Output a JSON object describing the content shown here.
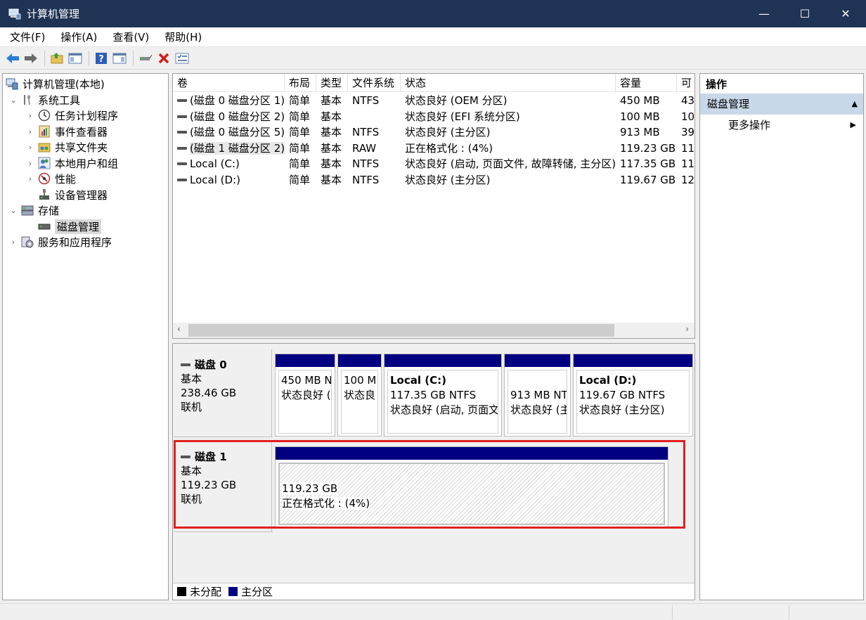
{
  "window": {
    "title": "计算机管理",
    "minimize": "—",
    "maximize": "☐",
    "close": "✕"
  },
  "menu": [
    "文件(F)",
    "操作(A)",
    "查看(V)",
    "帮助(H)"
  ],
  "toolbar_icons": [
    "back-arrow-icon",
    "forward-arrow-icon",
    "up-folder-icon",
    "show-hide-tree-icon",
    "help-icon",
    "properties-icon",
    "connect-drive-icon",
    "delete-icon",
    "checklist-icon"
  ],
  "tree": {
    "root": "计算机管理(本地)",
    "items": [
      {
        "label": "系统工具",
        "level": 1,
        "expanded": true
      },
      {
        "label": "任务计划程序",
        "level": 2
      },
      {
        "label": "事件查看器",
        "level": 2
      },
      {
        "label": "共享文件夹",
        "level": 2
      },
      {
        "label": "本地用户和组",
        "level": 2
      },
      {
        "label": "性能",
        "level": 2
      },
      {
        "label": "设备管理器",
        "level": 2
      },
      {
        "label": "存储",
        "level": 1,
        "expanded": true
      },
      {
        "label": "磁盘管理",
        "level": 2,
        "selected": true
      },
      {
        "label": "服务和应用程序",
        "level": 1
      }
    ]
  },
  "volume_list": {
    "columns": [
      "卷",
      "布局",
      "类型",
      "文件系统",
      "状态",
      "容量",
      "可"
    ],
    "rows": [
      [
        "(磁盘 0 磁盘分区 1)",
        "简单",
        "基本",
        "NTFS",
        "状态良好 (OEM 分区)",
        "450 MB",
        "43"
      ],
      [
        "(磁盘 0 磁盘分区 2)",
        "简单",
        "基本",
        "",
        "状态良好 (EFI 系统分区)",
        "100 MB",
        "10"
      ],
      [
        "(磁盘 0 磁盘分区 5)",
        "简单",
        "基本",
        "NTFS",
        "状态良好 (主分区)",
        "913 MB",
        "39"
      ],
      [
        "(磁盘 1 磁盘分区 2)",
        "简单",
        "基本",
        "RAW",
        "正在格式化 : (4%)",
        "119.23 GB",
        "11"
      ],
      [
        "Local (C:)",
        "简单",
        "基本",
        "NTFS",
        "状态良好 (启动, 页面文件, 故障转储, 主分区)",
        "117.35 GB",
        "11"
      ],
      [
        "Local (D:)",
        "简单",
        "基本",
        "NTFS",
        "状态良好 (主分区)",
        "119.67 GB",
        "12"
      ]
    ],
    "scroll_left": "‹",
    "scroll_right": "›"
  },
  "disks": [
    {
      "name": "磁盘 0",
      "type": "基本",
      "size": "238.46 GB",
      "state": "联机",
      "partitions": [
        {
          "name": "",
          "line1": "450 MB N",
          "line2": "状态良好 ("
        },
        {
          "name": "",
          "line1": "100 M",
          "line2": "状态良"
        },
        {
          "name": "Local  (C:)",
          "line1": "117.35 GB NTFS",
          "line2": "状态良好 (启动, 页面文"
        },
        {
          "name": "",
          "line1": "913 MB NT",
          "line2": "状态良好 (主"
        },
        {
          "name": "Local  (D:)",
          "line1": "119.67 GB NTFS",
          "line2": "状态良好 (主分区)"
        }
      ]
    },
    {
      "name": "磁盘 1",
      "type": "基本",
      "size": "119.23 GB",
      "state": "联机",
      "partitions": [
        {
          "name": "",
          "line1": "119.23 GB",
          "line2": "正在格式化 : (4%)"
        }
      ]
    }
  ],
  "legend": [
    {
      "label": "未分配",
      "color": "#000000"
    },
    {
      "label": "主分区",
      "color": "#000080"
    }
  ],
  "actions": {
    "header": "操作",
    "section": "磁盘管理",
    "section_caret": "▲",
    "items": [
      {
        "label": "更多操作",
        "caret": "▶"
      }
    ]
  },
  "colors": {
    "titlebar": "#1f3354",
    "primary_partition": "#000080",
    "highlight_box": "#e02020",
    "actions_section": "#c9d8e8"
  }
}
